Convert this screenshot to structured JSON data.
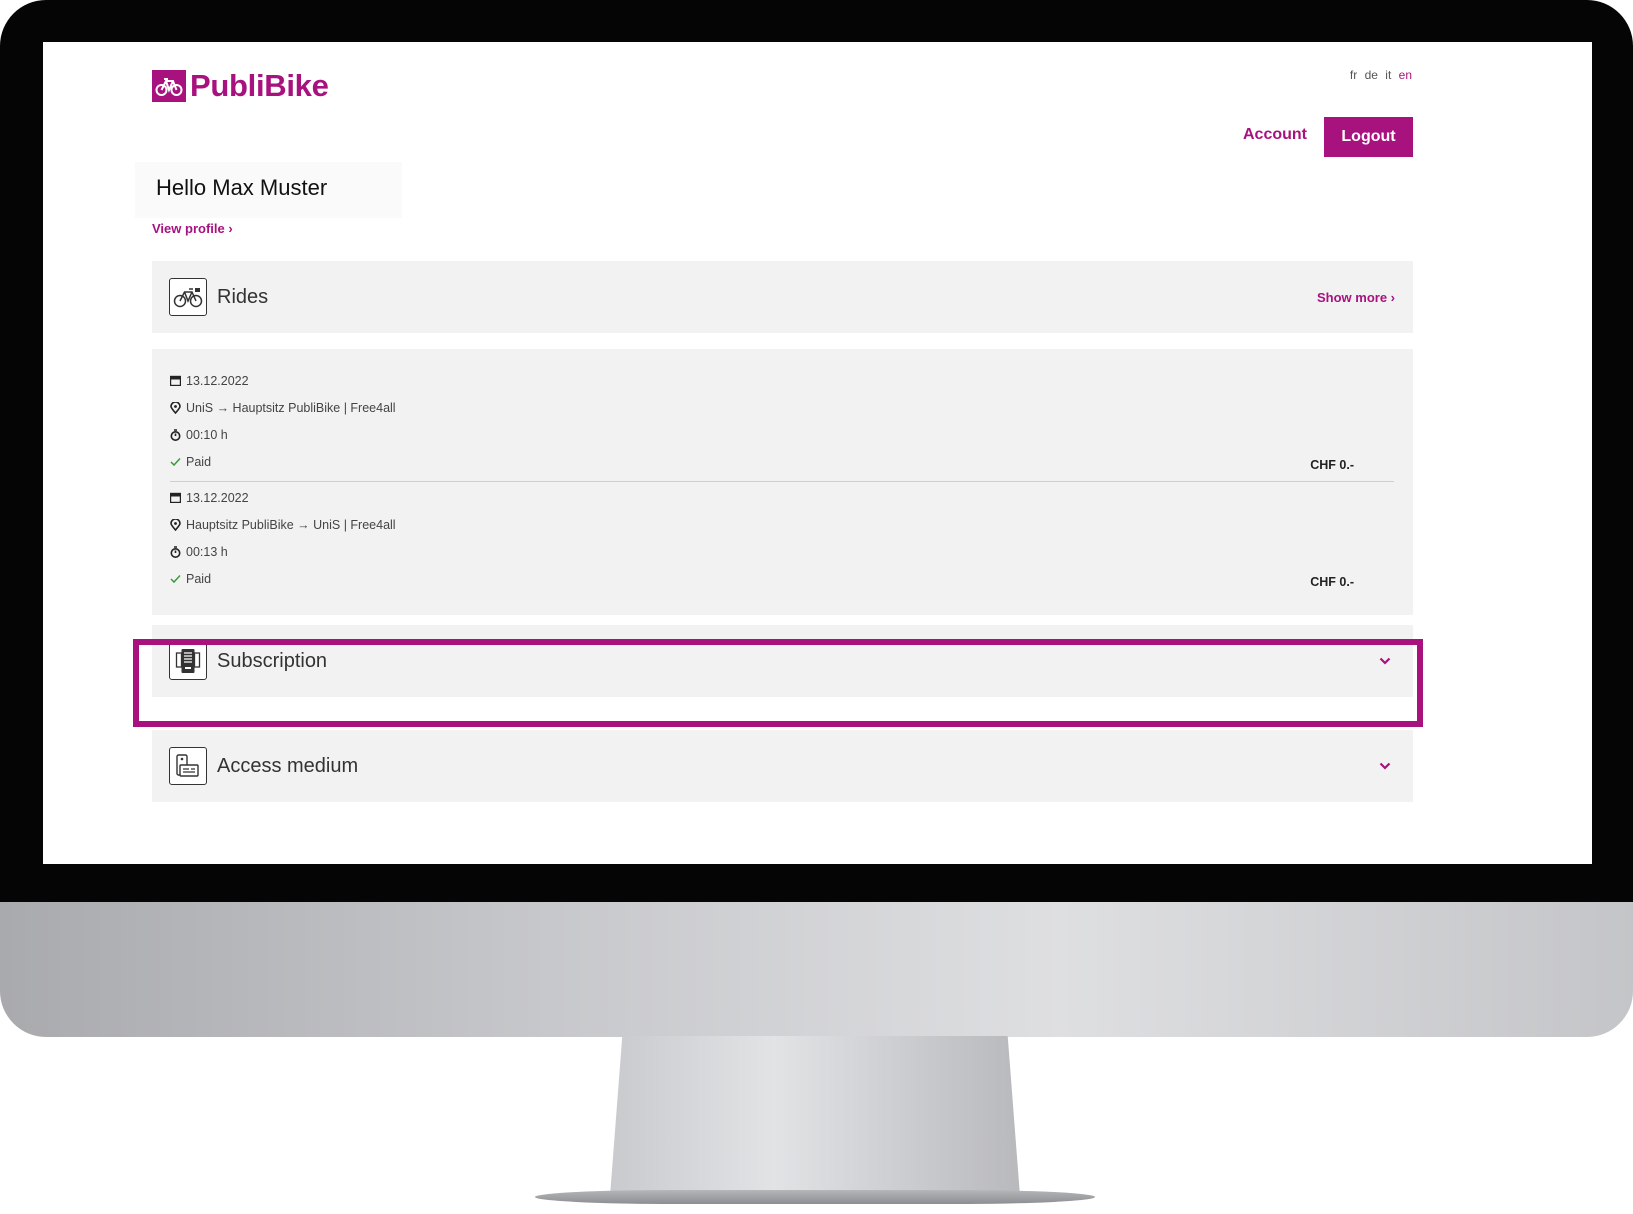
{
  "header": {
    "brand": "PubliBike",
    "languages": [
      {
        "code": "fr",
        "active": false
      },
      {
        "code": "de",
        "active": false
      },
      {
        "code": "it",
        "active": false
      },
      {
        "code": "en",
        "active": true
      }
    ],
    "account_label": "Account",
    "logout_label": "Logout"
  },
  "user": {
    "greeting": "Hello Max Muster",
    "view_profile_label": "View profile ›"
  },
  "rides": {
    "title": "Rides",
    "show_more_label": "Show more ›",
    "items": [
      {
        "date": "13.12.2022",
        "route": "UniS → Hauptsitz PubliBike | Free4all",
        "duration": "00:10 h",
        "status": "Paid",
        "price": "CHF 0.-"
      },
      {
        "date": "13.12.2022",
        "route": "Hauptsitz PubliBike → UniS | Free4all",
        "duration": "00:13 h",
        "status": "Paid",
        "price": "CHF 0.-"
      }
    ]
  },
  "subscription": {
    "title": "Subscription",
    "expanded": false
  },
  "access_medium": {
    "title": "Access medium",
    "expanded": false
  },
  "colors": {
    "brand": "#a8127f",
    "panel_bg": "#f2f2f2",
    "status_paid": "#3a9a3a"
  }
}
